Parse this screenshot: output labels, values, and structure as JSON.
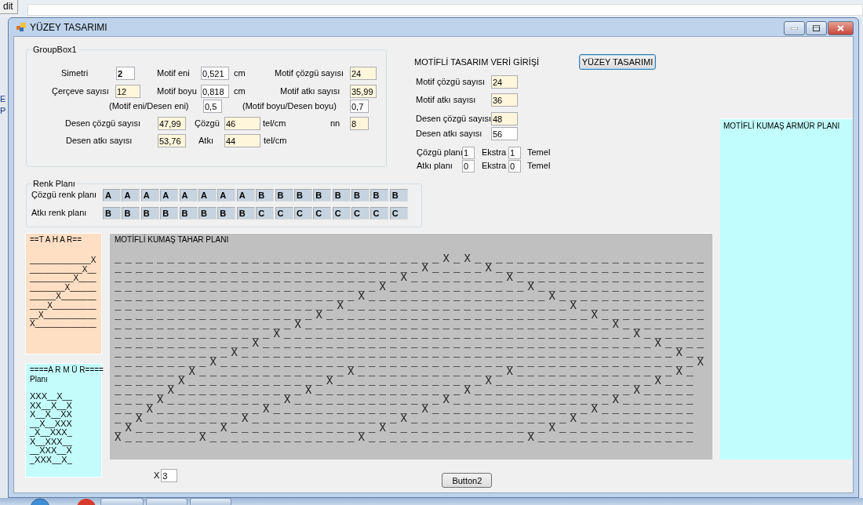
{
  "desktop": {
    "menu_fragment": "dit",
    "side_fragments": [
      "E",
      "P"
    ]
  },
  "window": {
    "title": "YÜZEY TASARIMI"
  },
  "groupbox1": {
    "title": "GroupBox1",
    "items": [
      {
        "kind": "label",
        "text": "Simetri"
      },
      {
        "kind": "field",
        "value": "2",
        "color": "#ffffff",
        "bold": true
      },
      {
        "kind": "label",
        "text": "Motif eni"
      },
      {
        "kind": "field",
        "value": "0,521",
        "color": "#ffffff"
      },
      {
        "kind": "label",
        "text": "cm"
      },
      {
        "kind": "label",
        "text": "Motif çözgü sayısı"
      },
      {
        "kind": "field",
        "value": "24",
        "color": "#fff6dc"
      },
      {
        "kind": "label",
        "text": "Çerçeve sayısı"
      },
      {
        "kind": "field",
        "value": "12",
        "color": "#fff6dc"
      },
      {
        "kind": "label",
        "text": "Motif boyu"
      },
      {
        "kind": "field",
        "value": "0,818",
        "color": "#ffffff"
      },
      {
        "kind": "label",
        "text": "cm"
      },
      {
        "kind": "label",
        "text": "Motif atkı sayısı"
      },
      {
        "kind": "field",
        "value": "35,99",
        "color": "#fff6dc"
      },
      {
        "kind": "label",
        "text": "(Motif eni/Desen eni)"
      },
      {
        "kind": "field",
        "value": "0,5",
        "color": "#ffffff"
      },
      {
        "kind": "label",
        "text": "(Motif boyu/Desen boyu)"
      },
      {
        "kind": "field",
        "value": "0,7",
        "color": "#ffffff"
      },
      {
        "kind": "label",
        "text": "Desen çözgü sayısı"
      },
      {
        "kind": "field",
        "value": "47,99",
        "color": "#fff6dc"
      },
      {
        "kind": "label",
        "text": "Çözgü"
      },
      {
        "kind": "field",
        "value": "46",
        "color": "#fff6dc"
      },
      {
        "kind": "label",
        "text": "tel/cm"
      },
      {
        "kind": "label",
        "text": "nn"
      },
      {
        "kind": "field",
        "value": "8",
        "color": "#fff6dc"
      },
      {
        "kind": "label",
        "text": "Desen atkı sayısı"
      },
      {
        "kind": "field",
        "value": "53,76",
        "color": "#fff6dc"
      },
      {
        "kind": "label",
        "text": "Atkı"
      },
      {
        "kind": "field",
        "value": "44",
        "color": "#fff6dc"
      },
      {
        "kind": "label",
        "text": "tel/cm"
      }
    ]
  },
  "veri_girisi": {
    "title": "MOTİFLİ TASARIM VERİ GİRİŞİ",
    "button": "YÜZEY TASARIMI",
    "fields": [
      {
        "label": "Motif çözgü sayısı",
        "value": "24",
        "color": "#fff6dc"
      },
      {
        "label": "Motif atkı sayısı",
        "value": "36",
        "color": "#fff6dc"
      },
      {
        "label": "Desen çözgü sayısı",
        "value": "48",
        "color": "#fff6dc"
      },
      {
        "label": "Desen atkı sayısı",
        "value": "56",
        "color": "#ffffff"
      }
    ],
    "plans": [
      {
        "label": "Çözgü planı",
        "value": "1",
        "extra_label": "Ekstra",
        "extra_value": "1",
        "suffix": "Temel"
      },
      {
        "label": "Atkı planı",
        "value": "0",
        "extra_label": "Ekstra",
        "extra_value": "0",
        "suffix": "Temel"
      }
    ]
  },
  "armur_plan_panel": {
    "title": "MOTİFLİ KUMAŞ ARMÜR PLANI"
  },
  "renk_plani": {
    "title": "Renk Planı",
    "rows": [
      {
        "label": "Çözgü renk planı",
        "cells": [
          "A",
          "A",
          "A",
          "A",
          "A",
          "A",
          "A",
          "A",
          "B",
          "B",
          "B",
          "B",
          "B",
          "B",
          "B",
          "B"
        ]
      },
      {
        "label": "Atkı renk planı",
        "cells": [
          "B",
          "B",
          "B",
          "B",
          "B",
          "B",
          "B",
          "B",
          "C",
          "C",
          "C",
          "C",
          "C",
          "C",
          "C",
          "C"
        ]
      }
    ]
  },
  "tahar": {
    "title": "==T A H A R==",
    "lines": [
      "______________X",
      "____________X__",
      "__________X____",
      "________X______",
      "______X________",
      "____X__________",
      "__X____________",
      "X______________"
    ]
  },
  "armur": {
    "title": "====A R M Ü R====",
    "subtitle": "Planı",
    "lines": [
      "XXX__X__",
      "XX__X__X",
      "X__X__XX",
      "__X__XXX",
      "_X__XXX_",
      "X__XXX__",
      "__XXX__X",
      "_XXX__X_"
    ]
  },
  "tahar_plan": {
    "title": "MOTİFLİ KUMAŞ TAHAR PLANI",
    "lines": [
      "_______________________________X_X______________________",
      "_____________________________X_____X____________________",
      "___________________________X_________X__________________",
      "_________________________X_____________X________________",
      "_______________________X_________________X______________",
      "_____________________X_____________________X____________",
      "___________________X_________________________X__________",
      "_________________X_____________________________X________",
      "_______________X_________________________________X______",
      "_____________X_____________________________________X____",
      "___________X_________________________________________X__",
      "_________X_____________________________________________X",
      "_______X______________X______________X_______________X_",
      "______X_____________X______________X_______________X___",
      "_____X____________X______________X_______________X_____",
      "____X___________X______________X_______________X_______",
      "___X__________X______________X_______________X_________",
      "__X_________X______________X_______________X___________",
      "_X________X______________X_______________X_____________",
      "X_______X______________X_______________X_______________"
    ]
  },
  "footer": {
    "multiplier_label": "X",
    "multiplier_value": "3",
    "button": "Button2"
  }
}
